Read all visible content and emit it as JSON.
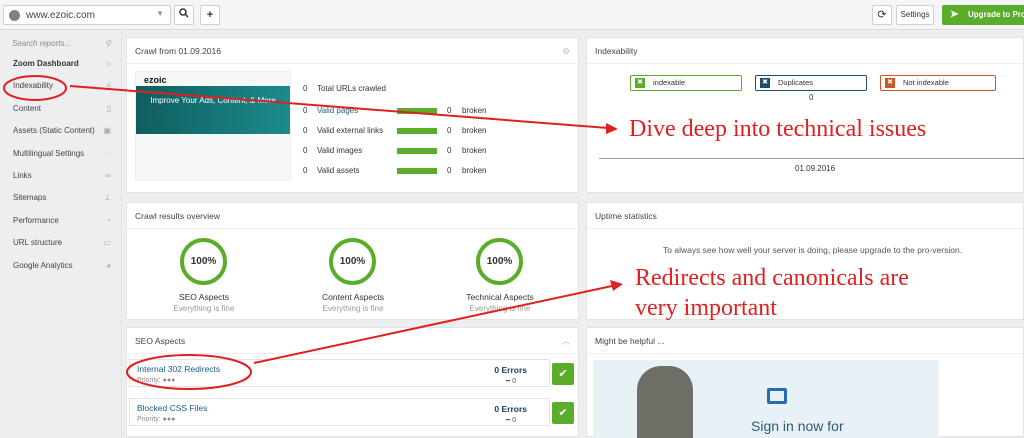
{
  "topbar": {
    "url": "www.ezoic.com",
    "settings_label": "Settings",
    "upgrade_label": "Upgrade to Pro N"
  },
  "sidebar": {
    "search_placeholder": "Search reports...",
    "items": [
      {
        "label": "Zoom Dashboard"
      },
      {
        "label": "Indexability"
      },
      {
        "label": "Content"
      },
      {
        "label": "Assets (Static Content)"
      },
      {
        "label": "Multilingual Settings"
      },
      {
        "label": "Links"
      },
      {
        "label": "Sitemaps"
      },
      {
        "label": "Performance"
      },
      {
        "label": "URL structure"
      },
      {
        "label": "Google Analytics"
      }
    ]
  },
  "crawl": {
    "title": "Crawl from 01.09.2016",
    "site_headline": "Improve Your Ads, Content, & More",
    "site_logo": "ezoic",
    "total": {
      "count": "0",
      "label": "Total URLs crawled"
    },
    "rows": [
      {
        "count": "0",
        "label": "Valid pages",
        "broken_count": "0",
        "broken_label": "broken"
      },
      {
        "count": "0",
        "label": "Valid external links",
        "broken_count": "0",
        "broken_label": "broken"
      },
      {
        "count": "0",
        "label": "Valid images",
        "broken_count": "0",
        "broken_label": "broken"
      },
      {
        "count": "0",
        "label": "Valid assets",
        "broken_count": "0",
        "broken_label": "broken"
      }
    ]
  },
  "indexability": {
    "title": "Indexability",
    "legend": [
      {
        "label": "indexable",
        "color": "#5aac2a"
      },
      {
        "label": "Duplicates",
        "color": "#1f4e6e"
      },
      {
        "label": "Not indexable",
        "color": "#d35424"
      }
    ],
    "duplicates_value": "0",
    "date": "01.09.2016"
  },
  "crawl_results": {
    "title": "Crawl results overview",
    "items": [
      {
        "value": "100%",
        "label": "SEO Aspects",
        "sub": "Everything is fine"
      },
      {
        "value": "100%",
        "label": "Content Aspects",
        "sub": "Everything is fine"
      },
      {
        "value": "100%",
        "label": "Technical Aspects",
        "sub": "Everything is fine"
      }
    ]
  },
  "uptime": {
    "title": "Uptime statistics",
    "message": "To always see how well your server is doing, please upgrade to the pro-version."
  },
  "seo": {
    "title": "SEO Aspects",
    "rows": [
      {
        "title": "Internal 302 Redirects",
        "priority": "Priority: ●●●",
        "errors": "0 Errors",
        "change": "━ 0"
      },
      {
        "title": "Blocked CSS Files",
        "priority": "Priority: ●●●",
        "errors": "0 Errors",
        "change": "━ 0"
      }
    ]
  },
  "helpful": {
    "title": "Might be helpful ...",
    "signin": "Sign in now for"
  },
  "annotations": {
    "a1": "Dive deep into technical issues",
    "a2_line1": "Redirects and canonicals are",
    "a2_line2": "very important"
  },
  "colors": {
    "accent_green": "#5aac2a",
    "annotation_red": "#e02020"
  }
}
